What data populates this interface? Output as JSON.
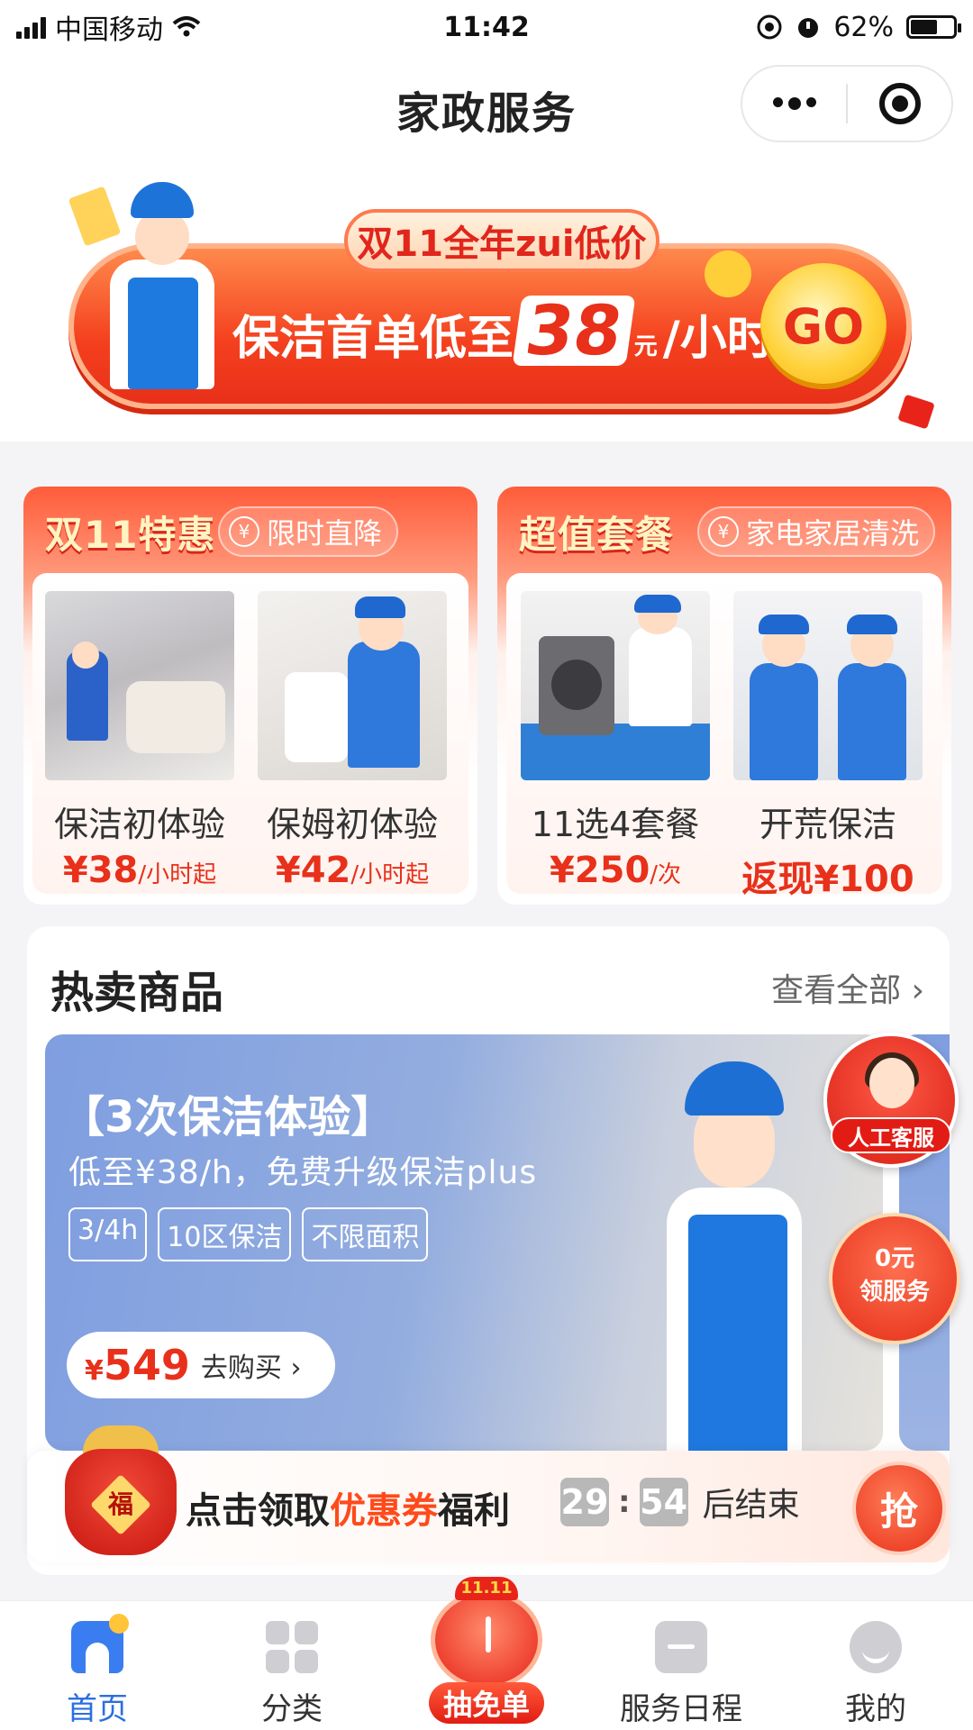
{
  "status_bar": {
    "carrier": "中国移动",
    "time": "11:42",
    "battery": "62%",
    "battery_level": 0.62
  },
  "nav": {
    "title": "家政服务",
    "more_icon": "more-dots-icon",
    "target_icon": "target-icon"
  },
  "hero_banner": {
    "tag": "双11全年zui低价",
    "headline_prefix": "保洁首单低至",
    "headline_number": "38",
    "headline_unit": "元",
    "headline_suffix": "/小时",
    "go_label": "GO",
    "colors": {
      "primary": "#f4401e",
      "gold": "#ffd23a"
    }
  },
  "promos": [
    {
      "title": "双11特惠",
      "badge": "限时直降",
      "items": [
        {
          "name": "保洁初体验",
          "price": "¥38",
          "unit": "/小时起"
        },
        {
          "name": "保姆初体验",
          "price": "¥42",
          "unit": "/小时起"
        }
      ]
    },
    {
      "title": "超值套餐",
      "badge": "家电家居清洗",
      "items": [
        {
          "name": "11选4套餐",
          "price": "¥250",
          "unit": "/次"
        },
        {
          "name": "开荒保洁",
          "price": "返现¥100",
          "unit": ""
        }
      ]
    }
  ],
  "hot": {
    "title": "热卖商品",
    "view_all": "查看全部 ›",
    "card": {
      "title": "【3次保洁体验】",
      "subtitle": "低至¥38/h，免费升级保洁plus",
      "tags": [
        "3/4h",
        "10区保洁",
        "不限面积"
      ],
      "currency": "¥",
      "price": "549",
      "buy_label": "去购买 ›"
    }
  },
  "floating": {
    "customer_service": "人工客服",
    "free_line1": "0元",
    "free_line2": "领服务"
  },
  "coupon": {
    "text_prefix": "点击领取",
    "text_highlight": "优惠券",
    "text_suffix": "福利",
    "bag_char": "福",
    "minutes": "29",
    "seconds": "54",
    "colon": ":",
    "end_text": "后结束",
    "grab": "抢"
  },
  "tabbar": {
    "home": "首页",
    "category": "分类",
    "lottery": "抽免单",
    "lottery_badge": "11.11",
    "schedule": "服务日程",
    "me": "我的"
  }
}
